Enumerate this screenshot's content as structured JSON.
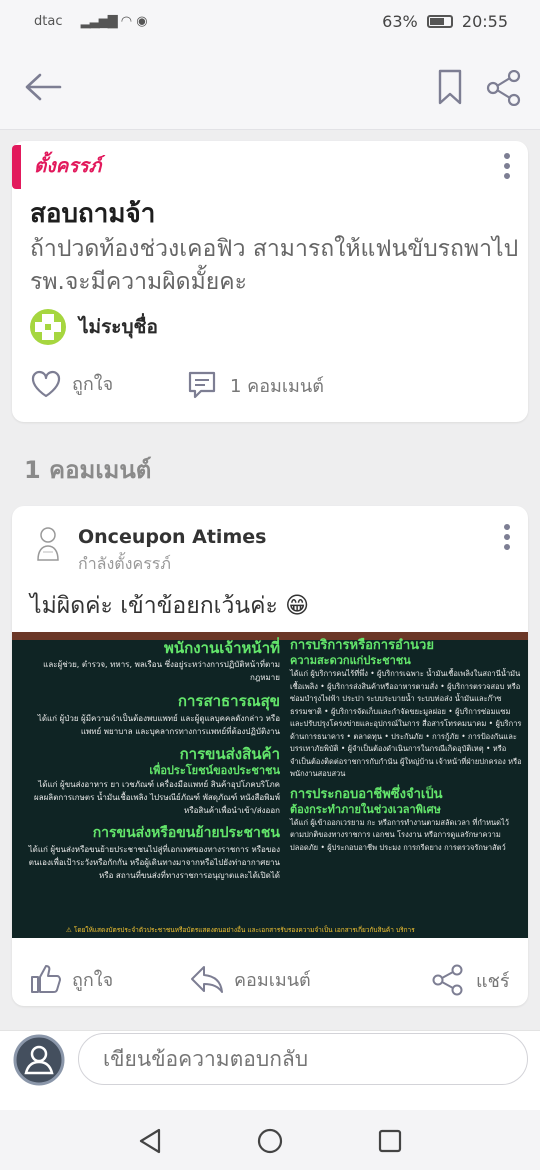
{
  "status": {
    "carrier": "dtac",
    "battery": "63%",
    "time": "20:55"
  },
  "post": {
    "tag": "ตั้งครรภ์",
    "title": "สอบถามจ้า",
    "body": "ถ้าปวดท้องช่วงเคอฟิว สามารถให้แฟนขับรถพาไปรพ.จะมีความผิดมั้ยคะ",
    "author": "ไม่ระบุชื่อ",
    "like_label": "ถูกใจ",
    "comment_count_label": "1 คอมเมนต์"
  },
  "comments_header": "1 คอมเมนต์",
  "comment": {
    "author": "Onceupon Atimes",
    "subtitle": "กำลังตั้งครรภ์",
    "text": "ไม่ผิดค่ะ เข้าข้อยกเว้นค่ะ 😁",
    "like_label": "ถูกใจ",
    "reply_label": "คอมเมนต์",
    "share_label": "แชร์"
  },
  "image_text": {
    "h1": "พนักงานเจ้าหน้าที่",
    "p1": "และผู้ช่วย, ตำรวจ, ทหาร, พลเรือน ซึ่งอยู่ระหว่างการปฏิบัติหน้าที่ตามกฎหมาย",
    "h2": "การสาธารณสุข",
    "p2": "ได้แก่ ผู้ป่วย ผู้มีความจำเป็นต้องพบแพทย์ และผู้ดูแลบุคคลดังกล่าว หรือ แพทย์ พยาบาล และบุคลากรทางการแพทย์ที่ต้องปฏิบัติงาน",
    "h3": "การขนส่งสินค้า",
    "h3b": "เพื่อประโยชน์ของประชาชน",
    "p3": "ได้แก่ ผู้ขนส่งอาหาร ยา เวชภัณฑ์ เครื่องมือแพทย์ สินค้าอุปโภคบริโภค ผลผลิตการเกษตร น้ำมันเชื้อเพลิง ไปรษณีย์ภัณฑ์ พัสดุภัณฑ์ หนังสือพิมพ์ หรือสินค้าเพื่อนำเข้า/ส่งออก",
    "h4": "การขนส่งหรือขนย้ายประชาชน",
    "p4": "ได้แก่ ผู้ขนส่งหรือขนย้ายประชาชนไปสู่ที่เอกเทศของทางราชการ หรือของตนเองเพื่อเป้าระวังหรือกักกัน หรือผู้เดินทางมาจากหรือไปยังท่าอากาศยาน หรือ สถานที่ขนส่งที่ทางราชการอนุญาตและได้เปิดได้",
    "h5": "การบริการหรือการอำนวย",
    "h5b": "ความสะดวกแก่ประชาชน",
    "p5": "ได้แก่ ผู้บริการคนไร้ที่พึ่ง • ผู้บริการเฉพาะ น้ำมันเชื้อเพลิงในสถานีน้ำมันเชื้อเพลิง • ผู้บริการส่งสินค้าหรืออาหารตามสั่ง • ผู้บริการตรวจสอบ หรือซ่อมบำรุงไฟฟ้า ประปา ระบบระบายน้ำ ระบบท่อส่ง น้ำมันและก๊าซธรรมชาติ • ผู้บริการจัดเก็บและกำจัดขยะมูลฝอย • ผู้บริการซ่อมแซมและปรับปรุงโครงข่ายและอุปกรณ์ในการ สื่อสารโทรคมนาคม • ผู้บริการด้านการธนาคาร • ตลาดทุน • ประกันภัย • การกู้ภัย • การป้องกันและบรรเทาภัยพิบัติ • ผู้จำเป็นต้องดำเนินการในกรณีเกิดอุบัติเหตุ • หรือจำเป็นต้องติดต่อราชการกับกำนัน ผู้ใหญ่บ้าน เจ้าหน้าที่ฝ่ายปกครอง หรือพนักงานสอบสวน",
    "h6": "การประกอบอาชีพซึ่งจำเป็น",
    "h6b": "ต้องกระทำภายในช่วงเวลาพิเศษ",
    "p6": "ได้แก่ ผู้เข้าออกเวรยาม กะ หรือการทำงานตามสลัดเวลา ที่กำหนดไว้ตามปกติของทางราชการ เอกชน โรงงาน หรือการดูแลรักษาความปลอดภัย • ผู้ประกอบอาชีพ ประมง การกรีดยาง การตรวจรักษาสัตว์",
    "footer": "⚠ โดยให้แสดงบัตรประจำตัวประชาชนหรือบัตรแสดงตนอย่างอื่น และเอกสารรับรองความจำเป็น เอกสารเกี่ยวกับสินค้า บริการ"
  },
  "reply_placeholder": "เขียนข้อความตอบกลับ",
  "colors": {
    "accent": "#e2195c",
    "icon": "#7d7e93",
    "image_green": "#63e56b",
    "image_bg": "#0f2424"
  }
}
